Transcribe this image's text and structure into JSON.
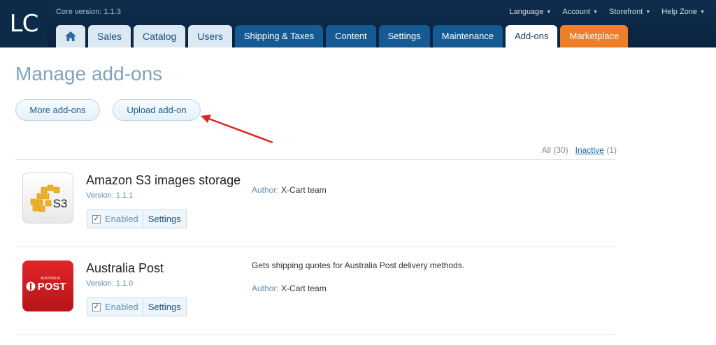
{
  "header": {
    "logo_text": "LC",
    "core_version": "Core version: 1.1.3",
    "top_menu": [
      {
        "label": "Language"
      },
      {
        "label": "Account"
      },
      {
        "label": "Storefront"
      },
      {
        "label": "Help Zone"
      }
    ],
    "tabs": [
      {
        "label": "Sales"
      },
      {
        "label": "Catalog"
      },
      {
        "label": "Users"
      },
      {
        "label": "Shipping & Taxes"
      },
      {
        "label": "Content"
      },
      {
        "label": "Settings"
      },
      {
        "label": "Maintenance"
      },
      {
        "label": "Add-ons"
      },
      {
        "label": "Marketplace"
      }
    ],
    "active_tab": "Add-ons"
  },
  "page": {
    "title": "Manage add-ons",
    "more_button": "More add-ons",
    "upload_button": "Upload add-on"
  },
  "filters": {
    "all_label": "All",
    "all_count": "(30)",
    "inactive_label": "Inactive",
    "inactive_count": "(1)"
  },
  "addons": [
    {
      "name": "Amazon S3 images storage",
      "version": "Version: 1.1.1",
      "description": "",
      "author_label": "Author:",
      "author": "X-Cart team",
      "enabled_label": "Enabled",
      "settings_label": "Settings",
      "icon_name": "amazon-s3-icon",
      "icon_text": "S3"
    },
    {
      "name": "Australia Post",
      "version": "Version: 1.1.0",
      "description": "Gets shipping quotes for Australia Post delivery methods.",
      "author_label": "Author:",
      "author": "X-Cart team",
      "enabled_label": "Enabled",
      "settings_label": "Settings",
      "icon_name": "australia-post-icon",
      "icon_text_small": "AUSTRALIA",
      "icon_text": "POST"
    }
  ],
  "colors": {
    "header_bg": "#0f2d4d",
    "tab_dark": "#155a92",
    "tab_light": "#dbe9f3",
    "marketplace": "#ee7f2a",
    "title": "#7ea3bf",
    "annotation_arrow": "#e02424"
  }
}
